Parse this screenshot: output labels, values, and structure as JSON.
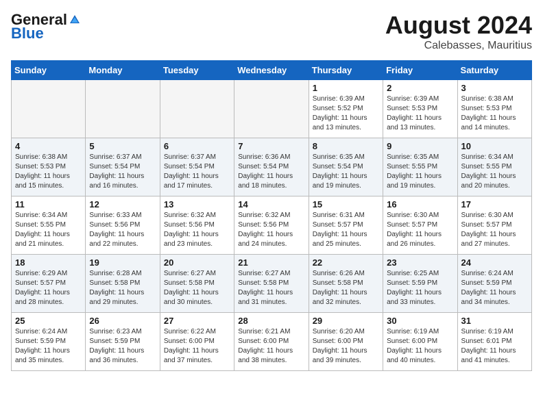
{
  "header": {
    "logo_general": "General",
    "logo_blue": "Blue",
    "month_year": "August 2024",
    "location": "Calebasses, Mauritius"
  },
  "weekdays": [
    "Sunday",
    "Monday",
    "Tuesday",
    "Wednesday",
    "Thursday",
    "Friday",
    "Saturday"
  ],
  "weeks": [
    [
      {
        "day": "",
        "info": ""
      },
      {
        "day": "",
        "info": ""
      },
      {
        "day": "",
        "info": ""
      },
      {
        "day": "",
        "info": ""
      },
      {
        "day": "1",
        "info": "Sunrise: 6:39 AM\nSunset: 5:52 PM\nDaylight: 11 hours\nand 13 minutes."
      },
      {
        "day": "2",
        "info": "Sunrise: 6:39 AM\nSunset: 5:53 PM\nDaylight: 11 hours\nand 13 minutes."
      },
      {
        "day": "3",
        "info": "Sunrise: 6:38 AM\nSunset: 5:53 PM\nDaylight: 11 hours\nand 14 minutes."
      }
    ],
    [
      {
        "day": "4",
        "info": "Sunrise: 6:38 AM\nSunset: 5:53 PM\nDaylight: 11 hours\nand 15 minutes."
      },
      {
        "day": "5",
        "info": "Sunrise: 6:37 AM\nSunset: 5:54 PM\nDaylight: 11 hours\nand 16 minutes."
      },
      {
        "day": "6",
        "info": "Sunrise: 6:37 AM\nSunset: 5:54 PM\nDaylight: 11 hours\nand 17 minutes."
      },
      {
        "day": "7",
        "info": "Sunrise: 6:36 AM\nSunset: 5:54 PM\nDaylight: 11 hours\nand 18 minutes."
      },
      {
        "day": "8",
        "info": "Sunrise: 6:35 AM\nSunset: 5:54 PM\nDaylight: 11 hours\nand 19 minutes."
      },
      {
        "day": "9",
        "info": "Sunrise: 6:35 AM\nSunset: 5:55 PM\nDaylight: 11 hours\nand 19 minutes."
      },
      {
        "day": "10",
        "info": "Sunrise: 6:34 AM\nSunset: 5:55 PM\nDaylight: 11 hours\nand 20 minutes."
      }
    ],
    [
      {
        "day": "11",
        "info": "Sunrise: 6:34 AM\nSunset: 5:55 PM\nDaylight: 11 hours\nand 21 minutes."
      },
      {
        "day": "12",
        "info": "Sunrise: 6:33 AM\nSunset: 5:56 PM\nDaylight: 11 hours\nand 22 minutes."
      },
      {
        "day": "13",
        "info": "Sunrise: 6:32 AM\nSunset: 5:56 PM\nDaylight: 11 hours\nand 23 minutes."
      },
      {
        "day": "14",
        "info": "Sunrise: 6:32 AM\nSunset: 5:56 PM\nDaylight: 11 hours\nand 24 minutes."
      },
      {
        "day": "15",
        "info": "Sunrise: 6:31 AM\nSunset: 5:57 PM\nDaylight: 11 hours\nand 25 minutes."
      },
      {
        "day": "16",
        "info": "Sunrise: 6:30 AM\nSunset: 5:57 PM\nDaylight: 11 hours\nand 26 minutes."
      },
      {
        "day": "17",
        "info": "Sunrise: 6:30 AM\nSunset: 5:57 PM\nDaylight: 11 hours\nand 27 minutes."
      }
    ],
    [
      {
        "day": "18",
        "info": "Sunrise: 6:29 AM\nSunset: 5:57 PM\nDaylight: 11 hours\nand 28 minutes."
      },
      {
        "day": "19",
        "info": "Sunrise: 6:28 AM\nSunset: 5:58 PM\nDaylight: 11 hours\nand 29 minutes."
      },
      {
        "day": "20",
        "info": "Sunrise: 6:27 AM\nSunset: 5:58 PM\nDaylight: 11 hours\nand 30 minutes."
      },
      {
        "day": "21",
        "info": "Sunrise: 6:27 AM\nSunset: 5:58 PM\nDaylight: 11 hours\nand 31 minutes."
      },
      {
        "day": "22",
        "info": "Sunrise: 6:26 AM\nSunset: 5:58 PM\nDaylight: 11 hours\nand 32 minutes."
      },
      {
        "day": "23",
        "info": "Sunrise: 6:25 AM\nSunset: 5:59 PM\nDaylight: 11 hours\nand 33 minutes."
      },
      {
        "day": "24",
        "info": "Sunrise: 6:24 AM\nSunset: 5:59 PM\nDaylight: 11 hours\nand 34 minutes."
      }
    ],
    [
      {
        "day": "25",
        "info": "Sunrise: 6:24 AM\nSunset: 5:59 PM\nDaylight: 11 hours\nand 35 minutes."
      },
      {
        "day": "26",
        "info": "Sunrise: 6:23 AM\nSunset: 5:59 PM\nDaylight: 11 hours\nand 36 minutes."
      },
      {
        "day": "27",
        "info": "Sunrise: 6:22 AM\nSunset: 6:00 PM\nDaylight: 11 hours\nand 37 minutes."
      },
      {
        "day": "28",
        "info": "Sunrise: 6:21 AM\nSunset: 6:00 PM\nDaylight: 11 hours\nand 38 minutes."
      },
      {
        "day": "29",
        "info": "Sunrise: 6:20 AM\nSunset: 6:00 PM\nDaylight: 11 hours\nand 39 minutes."
      },
      {
        "day": "30",
        "info": "Sunrise: 6:19 AM\nSunset: 6:00 PM\nDaylight: 11 hours\nand 40 minutes."
      },
      {
        "day": "31",
        "info": "Sunrise: 6:19 AM\nSunset: 6:01 PM\nDaylight: 11 hours\nand 41 minutes."
      }
    ]
  ]
}
